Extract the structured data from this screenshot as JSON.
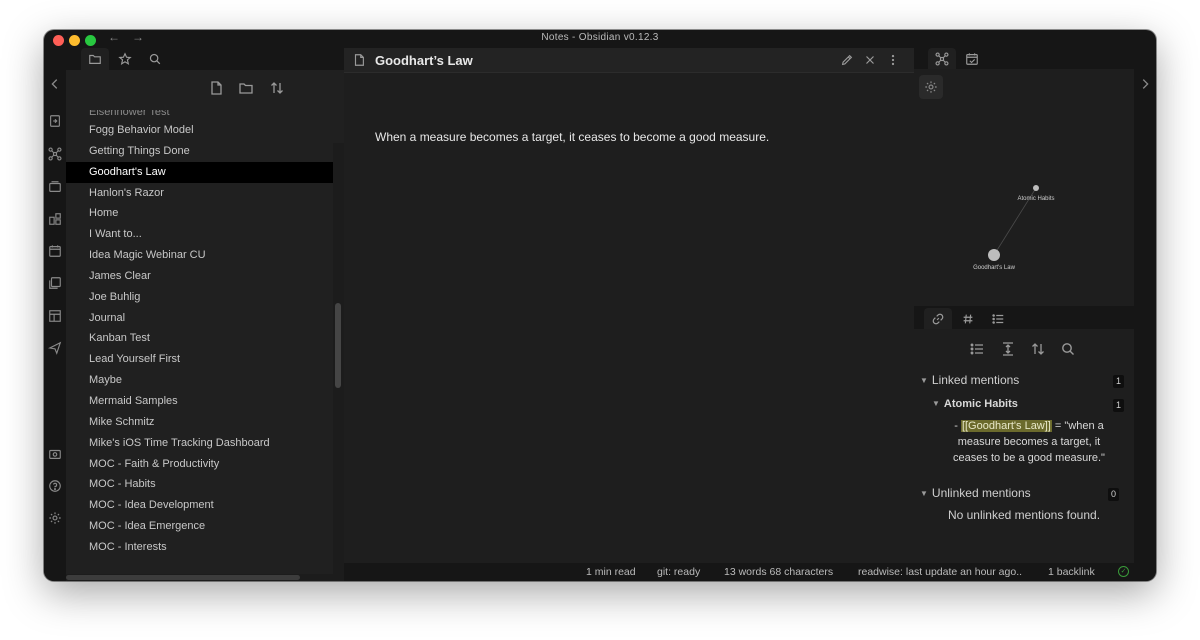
{
  "window": {
    "title": "Notes - Obsidian v0.12.3",
    "nav_back": "←",
    "nav_forward": "→"
  },
  "ribbon": {
    "icons": [
      "collapse-left-icon",
      "open-quick-switcher-icon",
      "graph-view-icon",
      "slides-icon",
      "plugin-icon",
      "daily-note-icon",
      "templates-icon",
      "kanban-icon",
      "send-icon",
      "vault-icon",
      "help-icon",
      "settings-icon"
    ]
  },
  "left_sidebar": {
    "tabs": [
      "file-explorer-icon",
      "starred-icon",
      "search-icon"
    ],
    "actions": [
      "new-note-icon",
      "new-folder-icon",
      "sort-icon"
    ],
    "partial_item": "Eisenhower Test",
    "files": [
      "Fogg Behavior Model",
      "Getting Things Done",
      "Goodhart's Law",
      "Hanlon's Razor",
      "Home",
      "I Want to...",
      "Idea Magic Webinar CU",
      "James Clear",
      "Joe Buhlig",
      "Journal",
      "Kanban Test",
      "Lead Yourself First",
      "Maybe",
      "Mermaid Samples",
      "Mike Schmitz",
      "Mike's iOS Time Tracking Dashboard",
      "MOC - Faith & Productivity",
      "MOC - Habits",
      "MOC - Idea Development",
      "MOC - Idea Emergence",
      "MOC - Interests"
    ],
    "active_file": "Goodhart's Law"
  },
  "main": {
    "title": "Goodhart’s Law",
    "content": "When a measure becomes a target, it ceases to become a good measure."
  },
  "graph": {
    "nodes": [
      {
        "label": "Atomic Habits"
      },
      {
        "label": "Goodhart's Law"
      }
    ]
  },
  "backlinks": {
    "linked_label": "Linked mentions",
    "linked_count": "1",
    "source_note": "Atomic Habits",
    "source_count": "1",
    "mention_prefix": "- ",
    "mention_link": "[[Goodhart's Law]]",
    "mention_rest": " = \"when a measure becomes a target, it ceases to be a good measure.\"",
    "unlinked_label": "Unlinked mentions",
    "unlinked_count": "0",
    "unlinked_empty": "No unlinked mentions found."
  },
  "status_bar": {
    "read_time": "1 min read",
    "git": "git: ready",
    "word_count": "13 words 68 characters",
    "readwise": "readwise: last update an hour ago..",
    "backlinks": "1 backlink"
  },
  "colors": {
    "background": "#1e1e1e",
    "sidebar": "#202020",
    "highlight": "#6b6a2c"
  }
}
